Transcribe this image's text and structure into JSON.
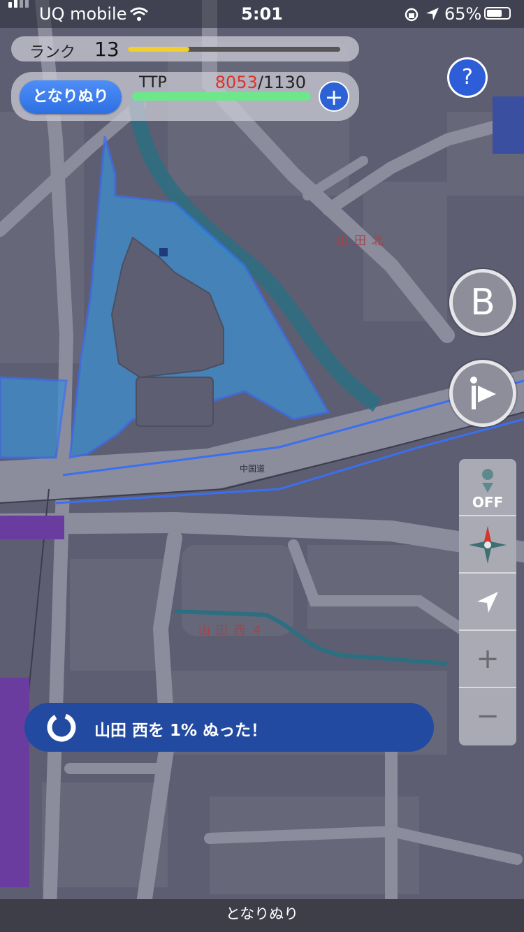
{
  "status_bar": {
    "carrier": "UQ mobile",
    "time": "5:01",
    "battery_percent": "65%",
    "icons": [
      "signal-icon",
      "wifi-icon",
      "orientation-lock-icon",
      "location-arrow-icon",
      "battery-icon"
    ]
  },
  "rank": {
    "label": "ランク",
    "value": "13",
    "progress_fraction": 0.29,
    "bar_color": "#f0cf2e"
  },
  "ttp": {
    "button_label": "となりぬり",
    "label": "TTP",
    "current": "8053",
    "max": "/1130",
    "current_color": "#d8342c",
    "bar_color": "#6ee68c",
    "plus_label": "+"
  },
  "help": {
    "label": "?"
  },
  "b_button": {
    "label": "B"
  },
  "side_panel": {
    "follow_label": "OFF",
    "zoom_in": "+",
    "zoom_out": "−",
    "icons": [
      "pin-icon",
      "compass-icon",
      "location-arrow-icon"
    ]
  },
  "map_labels": {
    "district_north": "山田北",
    "district_west": "山田西４",
    "road": "中国道"
  },
  "toast": {
    "message": "山田 西を 1% ぬった！"
  },
  "bottom_bar": {
    "title": "となりぬり"
  },
  "colors": {
    "map_background": "#5d5e72",
    "painted_area": "#3e8fd0",
    "river": "#2c6f80",
    "accent_blue": "#2d62d6"
  }
}
